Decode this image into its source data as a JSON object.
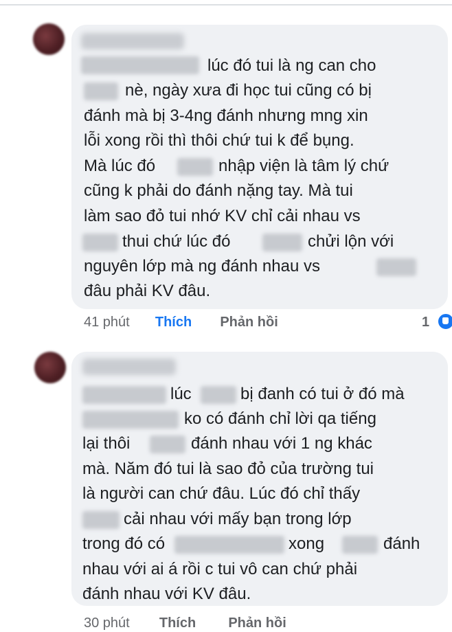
{
  "comments": [
    {
      "lines": [
        "lúc đó tui là ng can cho",
        "nè, ngày xưa đi học tui cũng có bị",
        "đánh mà bị 3-4ng đánh nhưng mng xin",
        "lỗi xong rồi thì thôi chứ tui k để bụng.",
        "Mà lúc đó",
        "nhập viện là tâm lý chứ",
        "cũng k phải do đánh nặng tay. Mà tui",
        "làm sao đỏ tui nhớ KV chỉ cải nhau vs",
        "thui chứ lúc đó",
        "chửi lộn với",
        "nguyên lớp mà ng đánh nhau vs",
        "đâu phải KV đâu."
      ],
      "time": "41 phút",
      "like": "Thích",
      "reply": "Phản hồi",
      "reaction_count": "1"
    },
    {
      "lines": [
        "lúc",
        "bị đanh có tui ở đó mà",
        "ko có đánh chỉ lời qa tiếng",
        "lại thôi",
        "đánh nhau với 1 ng khác",
        "mà. Năm đó tui là sao đỏ của trường tui",
        "là người can chứ đâu. Lúc đó chỉ thấy",
        "cải nhau với mấy bạn trong lớp",
        "trong đó có",
        "xong",
        "đánh",
        "nhau với ai á rồi c tui vô can chứ phải",
        "đánh nhau với KV đâu."
      ],
      "time": "30 phút",
      "like": "Thích",
      "reply": "Phản hồi"
    }
  ],
  "colors": {
    "bubble": "#eff1f4",
    "text": "#1c1e21",
    "meta": "#65676b",
    "like_active": "#1877f2"
  },
  "icons": [
    "like-reaction-icon"
  ]
}
